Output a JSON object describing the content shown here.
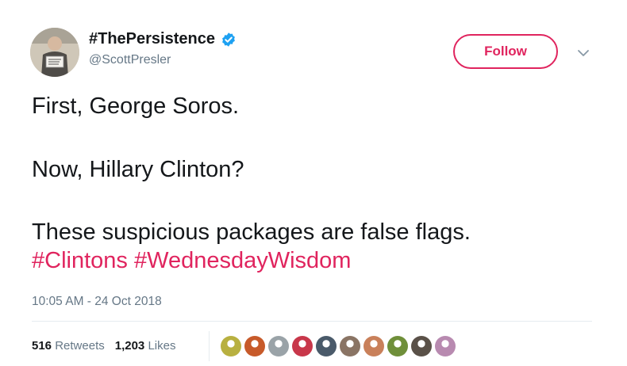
{
  "author": {
    "display_name": "#ThePersistence",
    "handle": "@ScottPresler",
    "verified": true,
    "avatar_icon": "profile-photo"
  },
  "follow_button": {
    "label": "Follow"
  },
  "menu_icon": "chevron-down-icon",
  "tweet": {
    "line1": "First, George Soros.",
    "line2": "Now, Hillary Clinton?",
    "line3": "These suspicious packages are false flags.",
    "hashtags": [
      "#Clintons",
      "#WednesdayWisdom"
    ]
  },
  "timestamp": "10:05 AM - 24 Oct 2018",
  "stats": {
    "retweets_count": "516",
    "retweets_label": "Retweets",
    "likes_count": "1,203",
    "likes_label": "Likes"
  },
  "likers": [
    {
      "color": "#b8b040"
    },
    {
      "color": "#c75a2a"
    },
    {
      "color": "#9aa3a8"
    },
    {
      "color": "#c8374a"
    },
    {
      "color": "#4a5a6a"
    },
    {
      "color": "#8a7464"
    },
    {
      "color": "#c9805a"
    },
    {
      "color": "#6f8f3a"
    },
    {
      "color": "#5a5148"
    },
    {
      "color": "#b88ab0"
    }
  ],
  "colors": {
    "accent": "#e0245e",
    "verified_blue": "#1da1f2",
    "secondary_text": "#657786"
  }
}
